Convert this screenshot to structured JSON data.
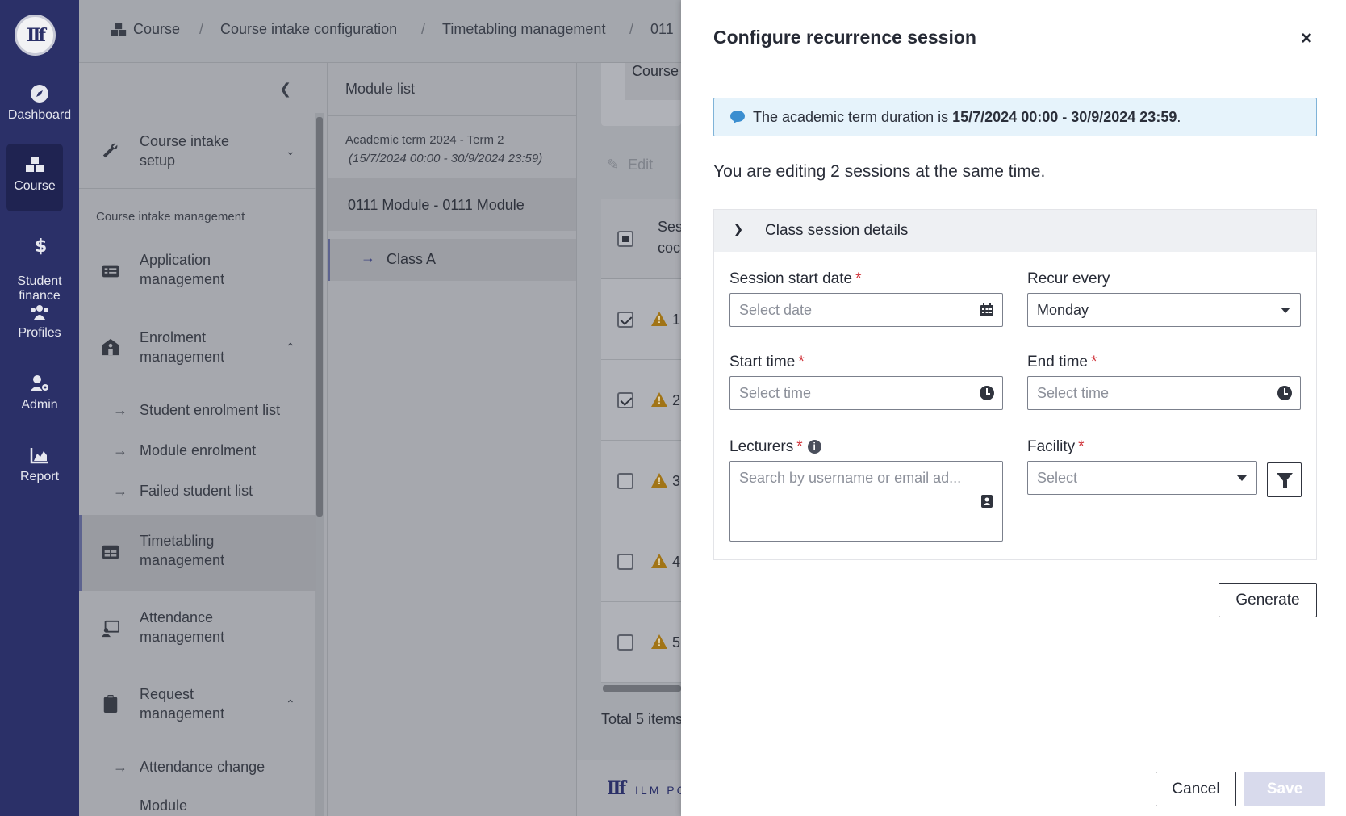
{
  "rail": {
    "logo": "IIf",
    "items": [
      {
        "label": "Dashboard",
        "icon": "compass-icon"
      },
      {
        "label": "Course",
        "icon": "cubes-icon"
      },
      {
        "label": "Student\nfinance",
        "icon": "dollar-icon"
      },
      {
        "label": "Profiles",
        "icon": "users-icon"
      },
      {
        "label": "Admin",
        "icon": "user-gear-icon"
      },
      {
        "label": "Report",
        "icon": "chart-area-icon"
      }
    ]
  },
  "breadcrumb": [
    "Course",
    "Course intake configuration",
    "Timetabling management",
    "011"
  ],
  "sidebar": {
    "items": [
      {
        "label": "Course intake\nsetup",
        "icon": "wrench-icon"
      },
      {
        "section": "Course intake management"
      },
      {
        "label": "Application\nmanagement",
        "icon": "list-icon"
      },
      {
        "label": "Enrolment\nmanagement",
        "icon": "school-icon"
      },
      {
        "sub": "Student enrolment list"
      },
      {
        "sub": "Module enrolment"
      },
      {
        "sub": "Failed student list"
      },
      {
        "label": "Timetabling\nmanagement",
        "icon": "table-icon"
      },
      {
        "label": "Attendance\nmanagement",
        "icon": "attendance-icon"
      },
      {
        "label": "Request\nmanagement",
        "icon": "clipboard-icon"
      },
      {
        "sub": "Attendance change"
      },
      {
        "sub": "Module"
      }
    ]
  },
  "module_list": {
    "title": "Module list",
    "term": "Academic term 2024 - Term 2",
    "term_dates": "(15/7/2024 00:00 - 30/9/2024 23:59)",
    "module": "0111 Module - 0111 Module",
    "class": "Class A"
  },
  "main": {
    "card_label": "Course",
    "edit_label": "Edit",
    "col_header": "Ses\ncoc",
    "rows": [
      "1",
      "2",
      "3",
      "4",
      "5"
    ],
    "total": "Total 5 items",
    "footer_text": "ILM PC"
  },
  "drawer": {
    "title": "Configure recurrence session",
    "close": "×",
    "info_prefix": "The academic term duration is ",
    "info_dates": "15/7/2024 00:00 - 30/9/2024 23:59",
    "info_suffix": ".",
    "editing_text": "You are editing 2 sessions at the same time.",
    "section_title": "Class session details",
    "session_start_label": "Session start date",
    "session_start_placeholder": "Select date",
    "recur_label": "Recur every",
    "recur_value": "Monday",
    "start_time_label": "Start time",
    "start_time_placeholder": "Select time",
    "end_time_label": "End time",
    "end_time_placeholder": "Select time",
    "lecturers_label": "Lecturers",
    "lecturers_placeholder": "Search by username or email ad...",
    "facility_label": "Facility",
    "facility_placeholder": "Select",
    "generate": "Generate",
    "cancel": "Cancel",
    "save": "Save",
    "required_mark": "*"
  },
  "colors": {
    "rail_bg": "#2b3068",
    "accent": "#3b8ed0",
    "required": "#d0333a",
    "save_disabled": "#d8daec"
  }
}
